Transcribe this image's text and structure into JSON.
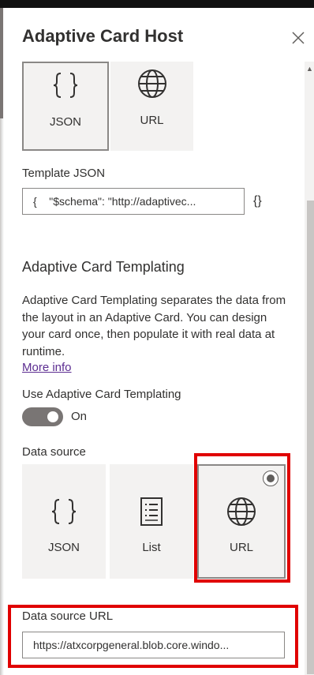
{
  "panel": {
    "title": "Adaptive Card Host"
  },
  "template_source": {
    "options": [
      {
        "label": "JSON",
        "icon": "curly-braces-icon",
        "selected": true
      },
      {
        "label": "URL",
        "icon": "globe-icon",
        "selected": false
      }
    ]
  },
  "template_json": {
    "label": "Template JSON",
    "value": "{    \"$schema\": \"http://adaptivec...",
    "edit_icon_text": "{}"
  },
  "templating": {
    "title": "Adaptive Card Templating",
    "description": "Adaptive Card Templating separates the data from the layout in an Adaptive Card. You can design your card once, then populate it with real data at runtime.",
    "more_info": "More info",
    "toggle_label": "Use Adaptive Card Templating",
    "toggle_state": "On",
    "toggle_on": true
  },
  "data_source": {
    "label": "Data source",
    "options": [
      {
        "label": "JSON",
        "icon": "curly-braces-icon",
        "selected": false
      },
      {
        "label": "List",
        "icon": "list-icon",
        "selected": false
      },
      {
        "label": "URL",
        "icon": "globe-icon",
        "selected": true
      }
    ]
  },
  "data_source_url": {
    "label": "Data source URL",
    "value": "https://atxcorpgeneral.blob.core.windo..."
  },
  "colors": {
    "highlight": "#e00000",
    "tile_bg": "#f3f2f1",
    "toggle_bg": "#797574",
    "link": "#5c2d91"
  }
}
